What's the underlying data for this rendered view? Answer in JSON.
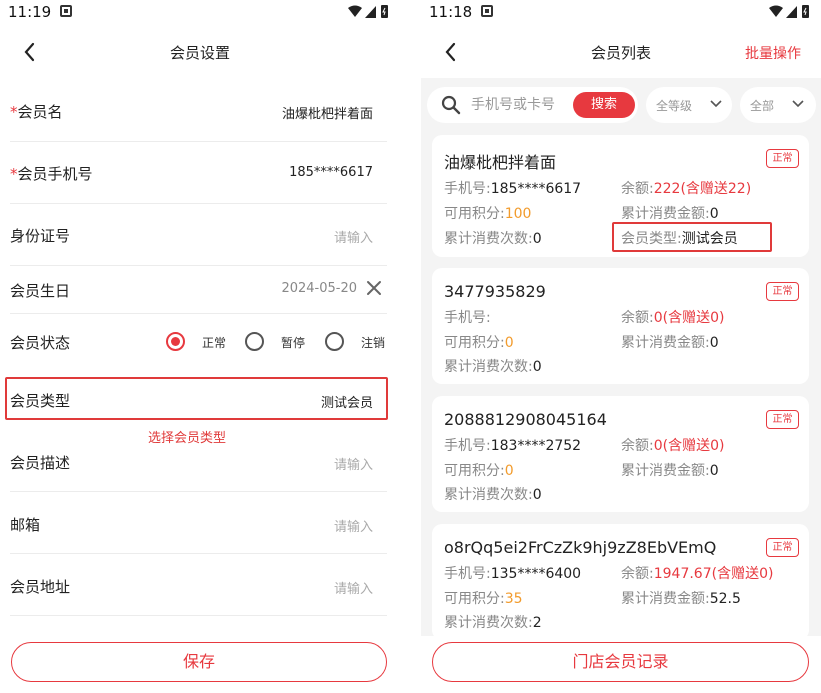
{
  "left": {
    "status": {
      "time": "11:19"
    },
    "nav": {
      "title": "会员设置"
    },
    "form": {
      "name": {
        "star": "*",
        "label": "会员名",
        "value": "油爆枇杷拌着面"
      },
      "phone": {
        "star": "*",
        "label": "会员手机号",
        "value": "185****6617"
      },
      "id_card": {
        "label": "身份证号",
        "placeholder": "请输入"
      },
      "birthday": {
        "label": "会员生日",
        "value": "2024-05-20"
      },
      "status": {
        "label": "会员状态",
        "options": [
          "正常",
          "暂停",
          "注销"
        ],
        "selected": "正常"
      },
      "type": {
        "label": "会员类型",
        "value": "测试会员"
      },
      "type_hint": "选择会员类型",
      "desc": {
        "label": "会员描述",
        "placeholder": "请输入"
      },
      "email": {
        "label": "邮箱",
        "placeholder": "请输入"
      },
      "address": {
        "label": "会员地址",
        "placeholder": "请输入"
      }
    },
    "save_label": "保存"
  },
  "right": {
    "status": {
      "time": "11:18"
    },
    "nav": {
      "title": "会员列表",
      "action": "批量操作"
    },
    "search": {
      "placeholder": "手机号或卡号",
      "button": "搜索"
    },
    "filters": {
      "level": "全等级",
      "all": "全部"
    },
    "labels": {
      "phone": "手机号:",
      "balance": "余额:",
      "points": "可用积分:",
      "total_amount": "累计消费金额:",
      "total_count": "累计消费次数:",
      "member_type": "会员类型:"
    },
    "members": [
      {
        "name": "油爆枇杷拌着面",
        "badge": "正常",
        "phone": "185****6617",
        "balance": "222(含赠送22)",
        "points": "100",
        "total_amount": "0",
        "total_count": "0",
        "member_type": "测试会员"
      },
      {
        "name": "3477935829",
        "badge": "正常",
        "phone": "",
        "balance": "0(含赠送0)",
        "points": "0",
        "total_amount": "0",
        "total_count": "0"
      },
      {
        "name": "2088812908045164",
        "badge": "正常",
        "phone": "183****2752",
        "balance": "0(含赠送0)",
        "points": "0",
        "total_amount": "0",
        "total_count": "0"
      },
      {
        "name": "o8rQq5ei2FrCzZk9hj9zZ8EbVEmQ",
        "badge": "正常",
        "phone": "135****6400",
        "balance": "1947.67(含赠送0)",
        "points": "35",
        "total_amount": "52.5",
        "total_count": "2"
      }
    ],
    "bottom_button": "门店会员记录"
  },
  "colors": {
    "accent": "#e7393f",
    "highlight": "#e03a3a",
    "points": "#f29b2c"
  }
}
